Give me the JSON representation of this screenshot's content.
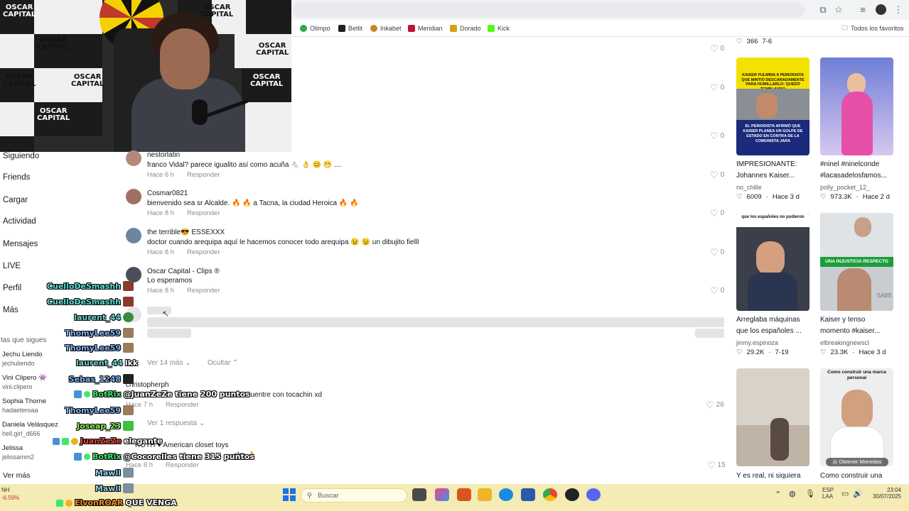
{
  "bookmarks": [
    {
      "label": "Olimpo",
      "color": "#2fa84f"
    },
    {
      "label": "Betlit",
      "color": "#222222"
    },
    {
      "label": "Inkabet",
      "color": "#c6881e"
    },
    {
      "label": "Meridian",
      "color": "#c0123a"
    },
    {
      "label": "Dorado",
      "color": "#d4a017"
    },
    {
      "label": "Kick",
      "color": "#53fc18"
    }
  ],
  "all_favorites": "Todos los favoritos",
  "overlay": {
    "brand_lines": [
      "OSCAR",
      "CAPITAL"
    ]
  },
  "nav": {
    "items": [
      "Siguiendo",
      "Friends",
      "Cargar",
      "Actividad",
      "Mensajes",
      "LIVE",
      "Perfil",
      "Más"
    ],
    "following_header": "tas que sigues",
    "following": [
      {
        "name": "Jechu Liendo",
        "id": "jechuliendo"
      },
      {
        "name": "Vini Clipero 👾",
        "id": "vini.clipero"
      },
      {
        "name": "Sophia Thorne",
        "id": "hadaeteroaa"
      },
      {
        "name": "Daniela Velásquez",
        "id": "hell.girl_d666"
      },
      {
        "name": "Jelissa",
        "id": "jelissamm2"
      }
    ],
    "see_more": "Ver más"
  },
  "comments": [
    {
      "user": "nestorlatin",
      "text": "franco Vidal? parece igualito así como acuña 🐁 👌 😊 😁 ....",
      "time": "Hace 6 h",
      "reply": "Responder",
      "likes": "0"
    },
    {
      "user": "Cosmar0821",
      "text": "bienvenido sea sr Alcalde. 🔥 🔥 a Tacna, la ciudad Heroica 🔥 🔥",
      "time": "Hace 8 h",
      "reply": "Responder",
      "likes": "0"
    },
    {
      "user": "the terrible😎 ESSEXXX",
      "text": "doctor cuando arequipa aquí le hacemos conocer todo arequipa 😉 😉 un dibujito fielll",
      "time": "Hace 8 h",
      "reply": "Responder",
      "likes": "0"
    },
    {
      "user": "Oscar Capital - Clips ®",
      "text": "Lo esperamos",
      "time": "Hace 8 h",
      "reply": "Responder",
      "likes": "0"
    },
    {
      "user": "christopherph",
      "text": "se encuentre con tocachin xd",
      "time": "Hace 7 h",
      "reply": "Responder",
      "likes": "26"
    },
    {
      "user": "ROTH ♥ American closet toys",
      "text": "che 👌",
      "time": "Hace 8 h",
      "reply": "Responder",
      "likes": "15"
    }
  ],
  "top_likes": [
    "0",
    "0",
    "0",
    "0"
  ],
  "expanders": {
    "see_more": "Ver 14 más",
    "hide": "Ocultar",
    "one_reply": "Ver 1 respuesta"
  },
  "chat": [
    {
      "user": "CuelloDeSmashh",
      "color": "#5ce0d8",
      "msg": ""
    },
    {
      "user": "CuelloDeSmashh",
      "color": "#5ce0d8",
      "msg": ""
    },
    {
      "user": "laurent_44",
      "color": "#6fd3c9",
      "msg": ""
    },
    {
      "user": "ThomyLee59",
      "color": "#7eb3f0",
      "msg": ""
    },
    {
      "user": "ThomyLee59",
      "color": "#7eb3f0",
      "msg": ""
    },
    {
      "user": "laurent_44",
      "color": "#6fd3c9",
      "msg": "lkk"
    },
    {
      "user": "Sebas_1248",
      "color": "#7eb3f0",
      "msg": ""
    },
    {
      "user": "BotRix",
      "color": "#3ee86a",
      "msg": "@JuanZeZe tiene 200 puntos"
    },
    {
      "user": "ThomyLee59",
      "color": "#7eb3f0",
      "msg": ""
    },
    {
      "user": "Joseap_23",
      "color": "#8ef05a",
      "msg": ""
    },
    {
      "user": "JuanZeZe",
      "color": "#e8423a",
      "msg": "elegante"
    },
    {
      "user": "BotRix",
      "color": "#3ee86a",
      "msg": "@Cocorelles tiene 315 puntos"
    },
    {
      "user": "Mawll",
      "color": "#8fd0f0",
      "msg": ""
    },
    {
      "user": "Mawll",
      "color": "#8fd0f0",
      "msg": ""
    },
    {
      "user": "ElvonROAR",
      "color": "#f08a2a",
      "msg": "QUE VENGA"
    }
  ],
  "videos": {
    "top_stats": {
      "likes": "366",
      "date": "7-6"
    },
    "items": [
      {
        "caption_lines": [
          "IMPRESIONANTE:",
          "Johannes Kaiser..."
        ],
        "author": "no_chille",
        "likes": "6009",
        "date": "Hace 3 d",
        "thumb_text": "KAISER FULMINA A PERIODISTA QUE MINTIÓ DESCARADAMENTE PARA HUMILLARLO: QUEDÓ TEMBLANDO",
        "thumb_text2": "EL PERIODISTA AFIRMÓ QUE KAISER PLANEA UN GOLPE DE ESTADO EN CONTRA DE LA COMUNISTA JARA"
      },
      {
        "caption_lines": [
          "#ninel #ninelconde",
          "#lacasadelosfamos..."
        ],
        "author": "polly_pocket_12_",
        "likes": "973.3K",
        "date": "Hace 2 d",
        "thumb_text": "",
        "thumb_text2": ""
      },
      {
        "caption_lines": [
          "Arreglaba máquinas",
          "que los españoles ..."
        ],
        "author": "jinmy.espinoza",
        "likes": "29.2K",
        "date": "7-19",
        "thumb_text": "que los españoles no pudieron",
        "thumb_text2": ""
      },
      {
        "caption_lines": [
          "Kaiser y tenso",
          "momento #kaiser..."
        ],
        "author": "elbreakingnewscl",
        "likes": "23.3K",
        "date": "Hace 3 d",
        "thumb_text": "UNA INJUSTICIA RESPECTO",
        "thumb_text2": "SABE"
      },
      {
        "caption_lines": [
          "Y es real, ni siquiera",
          ""
        ],
        "author": "",
        "likes": "",
        "date": "",
        "thumb_text": "",
        "thumb_text2": ""
      },
      {
        "caption_lines": [
          "Como construir una",
          ""
        ],
        "author": "",
        "likes": "",
        "date": "",
        "thumb_text": "Como construir una marca personal",
        "thumb_text2": "Obtener Monedas"
      }
    ]
  },
  "taskbar": {
    "search_placeholder": "Buscar",
    "lang_top": "ESP",
    "lang_bottom": "LAA",
    "time": "23:04",
    "date": "30/07/2025",
    "left_top": "NH",
    "left_bottom": "-6.59%"
  }
}
